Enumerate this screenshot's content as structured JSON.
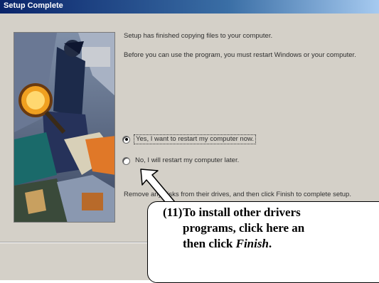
{
  "window": {
    "title": "Setup Complete"
  },
  "main": {
    "message_1": "Setup has finished copying files to your computer.",
    "message_2": "Before you can use the program, you must restart Windows or your computer.",
    "options": [
      {
        "label": "Yes, I want to restart my computer now.",
        "selected": true
      },
      {
        "label": "No, I will restart my computer later.",
        "selected": false
      }
    ],
    "message_3": "Remove any disks from their drives, and then click Finish to complete setup."
  },
  "annotation": {
    "number": "(11)",
    "line_1": "To install other drivers",
    "line_2": "programs, click here an",
    "line_3_prefix": "then click ",
    "line_3_emphasis": "Finish",
    "line_3_suffix": "."
  },
  "colors": {
    "title_bar": "#0a246a",
    "dialog_bg": "#d4d0c8"
  }
}
